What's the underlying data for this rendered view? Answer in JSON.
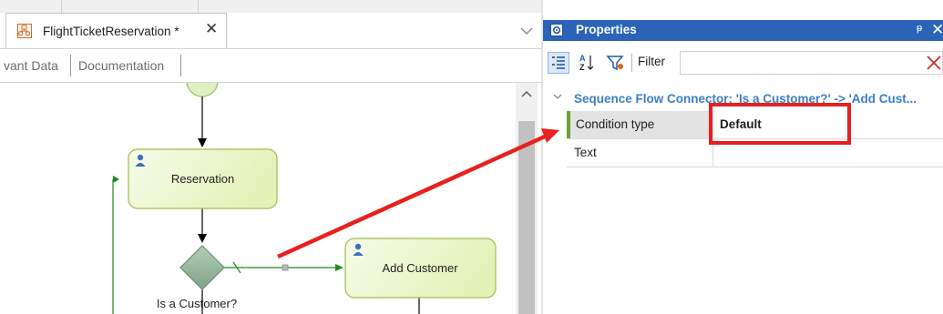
{
  "editor": {
    "tab": {
      "title": "FlightTicketReservation *",
      "close_glyph": "✕",
      "icon": "workflow-diagram-icon"
    },
    "subtabs": [
      "vant Data",
      "Documentation"
    ],
    "diagram": {
      "tasks": [
        {
          "label": "Reservation"
        },
        {
          "label": "Add Customer"
        }
      ],
      "gateway": {
        "label": "Is a Customer?"
      }
    }
  },
  "properties": {
    "title": "Properties",
    "pin_glyph": "ᵽ",
    "close_glyph": "✕",
    "filter_label": "Filter",
    "filter_value": "",
    "group_title": "Sequence Flow Connector: 'Is a Customer?' -> 'Add Cust...",
    "rows": [
      {
        "name": "Condition type",
        "value": "Default"
      },
      {
        "name": "Text",
        "value": ""
      }
    ]
  },
  "colors": {
    "task_fill": "#e4f2b8",
    "task_border": "#9dbe4b",
    "gateway_fill": "#97b79c",
    "flow_line": "#1f8c1f",
    "annotation": "#e8201e",
    "panel_header": "#2b63b8",
    "group_title": "#3d7ec6"
  }
}
